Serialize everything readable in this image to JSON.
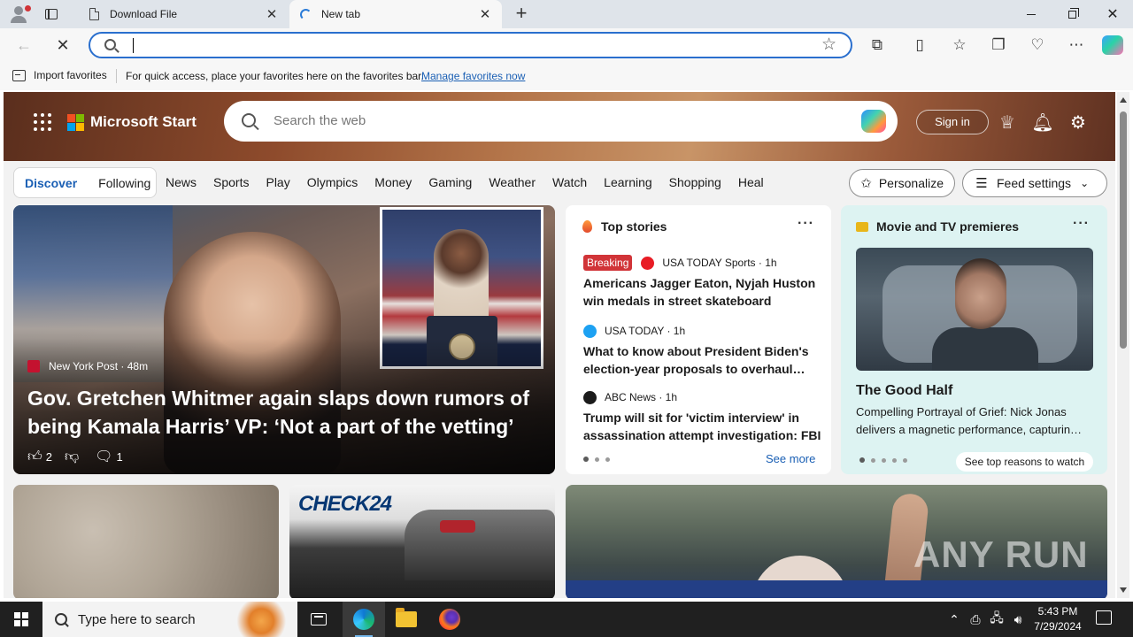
{
  "browser": {
    "tabs": [
      {
        "label": "Download File",
        "icon": "document-icon",
        "active": false
      },
      {
        "label": "New tab",
        "icon": "loading-spinner-icon",
        "active": true
      }
    ],
    "address_value": "",
    "favorites_bar": {
      "import_label": "Import favorites",
      "message": "For quick access, place your favorites here on the favorites bar.",
      "manage_link": "Manage favorites now"
    }
  },
  "page": {
    "brand": "Microsoft Start",
    "search_placeholder": "Search the web",
    "sign_in": "Sign in",
    "feed_tabs": [
      "Discover",
      "Following"
    ],
    "active_feed_tab": "Discover",
    "nav": [
      "News",
      "Sports",
      "Play",
      "Olympics",
      "Money",
      "Gaming",
      "Weather",
      "Watch",
      "Learning",
      "Shopping",
      "Heal"
    ],
    "personalize": "Personalize",
    "feed_settings": "Feed settings",
    "main_story": {
      "source": "New York Post",
      "age": "48m",
      "headline": "Gov. Gretchen Whitmer again slaps down rumors of being Kamala Harris’ VP: ‘Not a part of the vetting’",
      "likes": "2",
      "comments": "1"
    },
    "top_stories": {
      "title": "Top stories",
      "items": [
        {
          "badge": "Breaking",
          "source": "USA TODAY Sports · 1h",
          "title": "Americans Jagger Eaton, Nyjah Huston win medals in street skateboard",
          "icon_color": "#e81c25"
        },
        {
          "badge": "",
          "source": "USA TODAY · 1h",
          "title": "What to know about President Biden's election-year proposals to overhaul…",
          "icon_color": "#1da1f2"
        },
        {
          "badge": "",
          "source": "ABC News · 1h",
          "title": "Trump will sit for 'victim interview' in assassination attempt investigation: FBI",
          "icon_color": "#1b1b1b"
        }
      ],
      "see_more": "See more"
    },
    "movie_card": {
      "title": "Movie and TV premieres",
      "movie_title": "The Good Half",
      "description": "Compelling Portrayal of Grief: Nick Jonas delivers a magnetic performance, capturin…",
      "cta": "See top reasons to watch"
    },
    "check24_logo": "CHECK24",
    "watermark": "ANY RUN"
  },
  "taskbar": {
    "search_placeholder": "Type here to search",
    "time": "5:43 PM",
    "date": "7/29/2024"
  },
  "colors": {
    "accent": "#1a5fb4",
    "breaking": "#d13438",
    "movie_card_bg": "#ddf3f2",
    "taskbar": "#202020"
  }
}
